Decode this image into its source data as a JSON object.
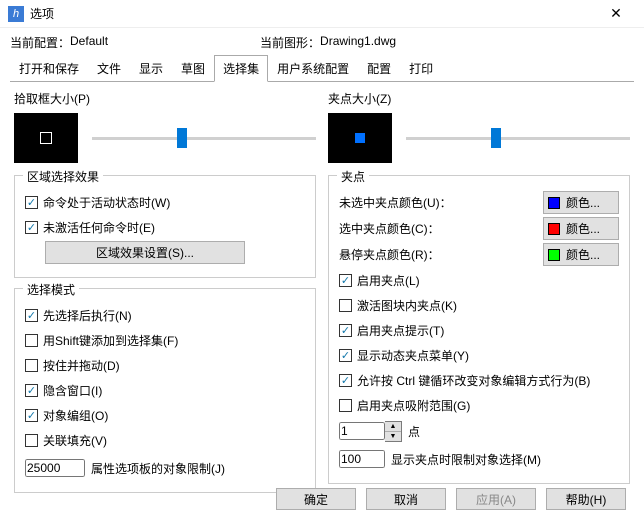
{
  "window": {
    "title": "选项"
  },
  "header": {
    "cfg_label": "当前配置：",
    "cfg_value": "Default",
    "dwg_label": "当前图形：",
    "dwg_value": "Drawing1.dwg"
  },
  "tabs": [
    "打开和保存",
    "文件",
    "显示",
    "草图",
    "选择集",
    "用户系统配置",
    "配置",
    "打印"
  ],
  "active_tab": 4,
  "left": {
    "pickbox_label": "拾取框大小(P)",
    "region_title": "区域选择效果",
    "region_chk1": "命令处于活动状态时(W)",
    "region_chk2": "未激活任何命令时(E)",
    "region_btn": "区域效果设置(S)...",
    "mode_title": "选择模式",
    "mode": {
      "c1": "先选择后执行(N)",
      "c2": "用Shift键添加到选择集(F)",
      "c3": "按住并拖动(D)",
      "c4": "隐含窗口(I)",
      "c5": "对象编组(O)",
      "c6": "关联填充(V)"
    },
    "limit_value": "25000",
    "limit_label": "属性选项板的对象限制(J)"
  },
  "right": {
    "grip_label": "夹点大小(Z)",
    "grip_title": "夹点",
    "color_unsel_lbl": "未选中夹点颜色(U)：",
    "color_sel_lbl": "选中夹点颜色(C)：",
    "color_hover_lbl": "悬停夹点颜色(R)：",
    "color_btn": "颜色...",
    "g": {
      "c1": "启用夹点(L)",
      "c2": "激活图块内夹点(K)",
      "c3": "启用夹点提示(T)",
      "c4": "显示动态夹点菜单(Y)",
      "c5": "允许按 Ctrl 键循环改变对象编辑方式行为(B)",
      "c6": "启用夹点吸附范围(G)"
    },
    "range_value": "1",
    "range_suffix": "点",
    "select_value": "100",
    "select_label": "显示夹点时限制对象选择(M)"
  },
  "footer": {
    "ok": "确定",
    "cancel": "取消",
    "apply": "应用(A)",
    "help": "帮助(H)"
  }
}
